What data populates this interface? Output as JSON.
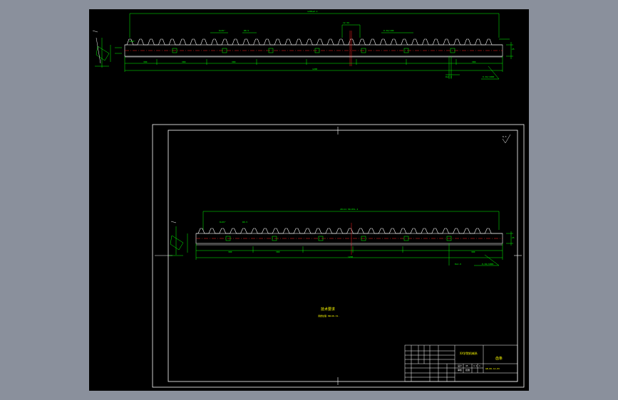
{
  "viewport": {
    "background": "#8a909c",
    "model_space_background": "#000000",
    "colors": {
      "outline": "#ffffff",
      "dimension": "#00ff00",
      "centerline": "#ff2020",
      "notes": "#ffff00"
    }
  },
  "detail_view": {
    "overall_length": "1200±0.2",
    "tooth_mark_left": "8×45°",
    "tooth_mark_mid": "R0.5",
    "section_mark": "4×45°",
    "tolerance_mark": "0.04/100",
    "pitch_mark": "12.56",
    "height_mark": "25",
    "segment_1": "300",
    "segment_2": "300",
    "segment_3": "300",
    "segment_4": "300",
    "total_bottom": "1200",
    "roughness_mark": "Ra1.6",
    "flatness_mark": "0.02/1000"
  },
  "sheet_view": {
    "overall_length": "20×12.56=251.2",
    "tooth_mark_left": "8×45°",
    "tooth_mark_mid": "R0.5",
    "segment_1": "300",
    "segment_2": "300",
    "segment_3": "300",
    "total_bottom": "1200",
    "roughness_mark": "Ra1.6",
    "flatness_mark": "0.02/1000",
    "roughness_symbol": "6.3",
    "side_mark": "25"
  },
  "notes": {
    "title": "技术要求",
    "body": "调质处理 HRC28-32."
  },
  "title_block": {
    "part_name": "齿条",
    "material": "45",
    "drawing_no": "GB-06-12-03",
    "school": "XX学院机械系",
    "scale": "1:1",
    "sheet": "1",
    "designer": "设计",
    "checker": "审核",
    "approve": "批准"
  }
}
